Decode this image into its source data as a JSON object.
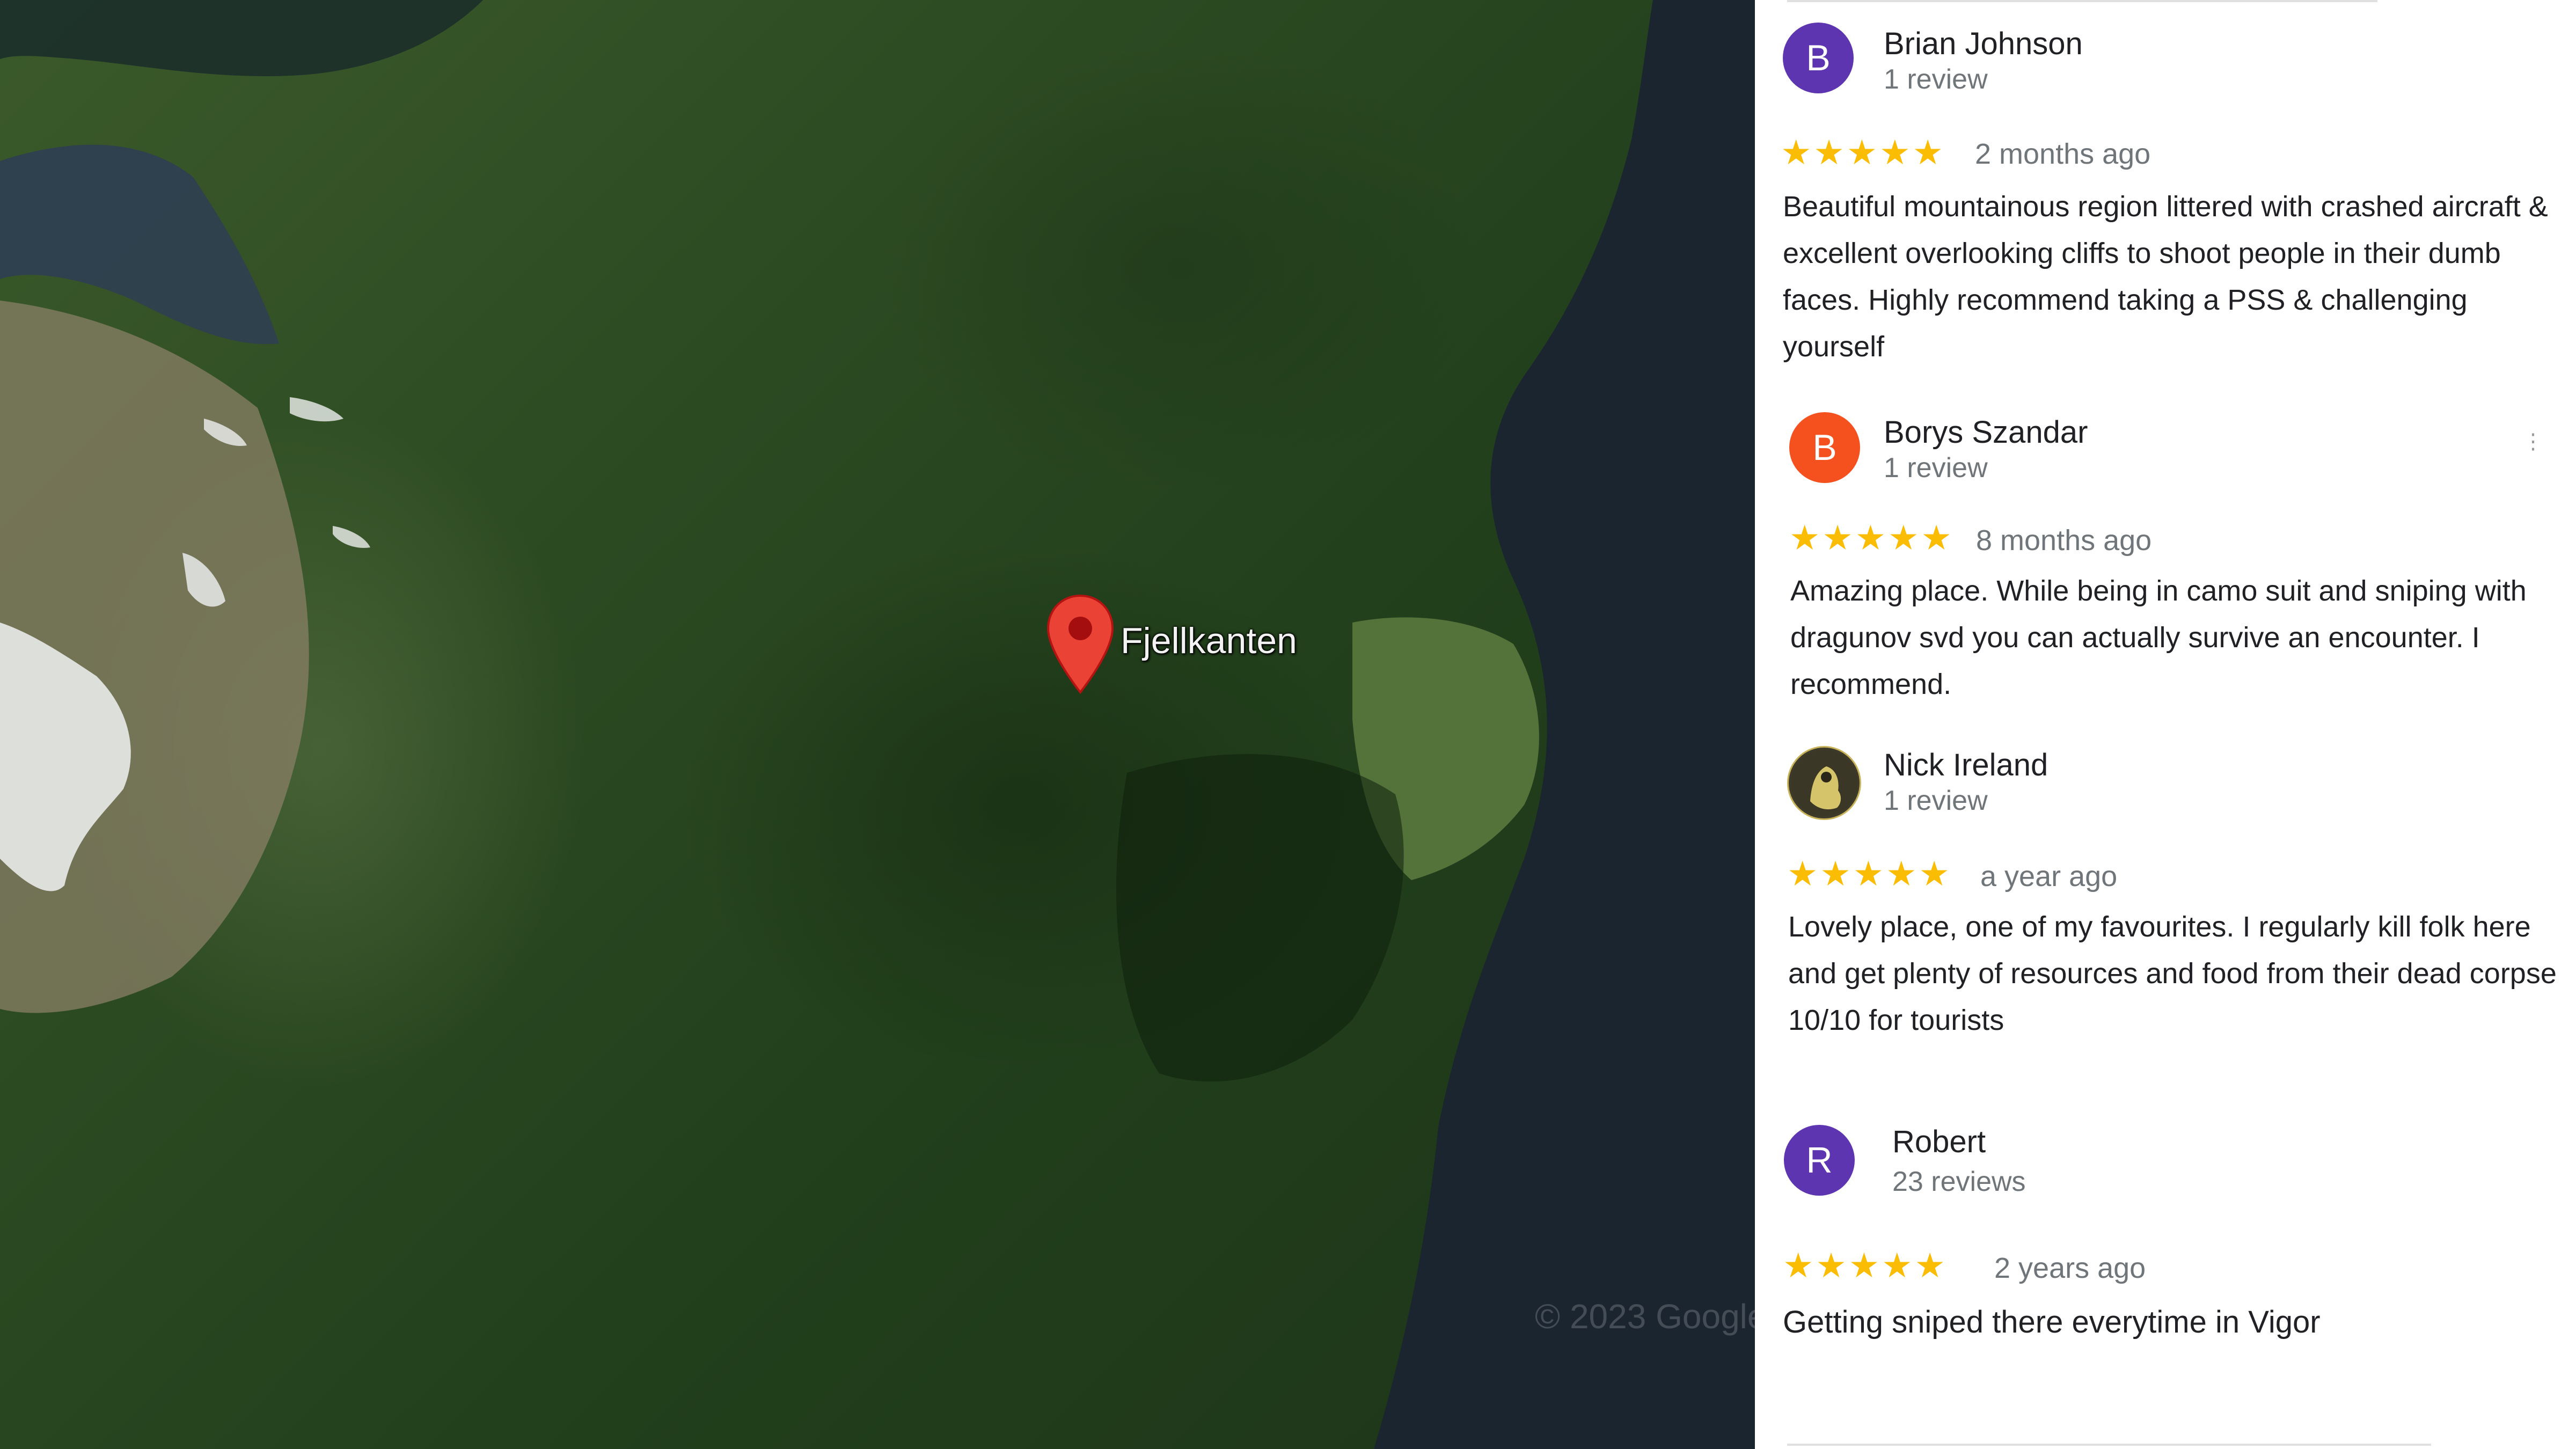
{
  "map": {
    "place_label": "Fjellkanten",
    "watermark": "© 2023 Google",
    "pin_color": "#ea4335"
  },
  "reviews": [
    {
      "initial": "B",
      "avatar_color": "#5e35b1",
      "name": "Brian Johnson",
      "review_count": "1 review",
      "rating": 5,
      "stars": "★★★★★",
      "time": "2 months ago",
      "text": "Beautiful mountainous region littered with crashed aircraft & excellent overlooking cliffs to shoot people in their dumb faces. Highly recommend taking a PSS & challenging yourself"
    },
    {
      "initial": "B",
      "avatar_color": "#f4511e",
      "name": "Borys Szandar",
      "review_count": "1 review",
      "rating": 5,
      "stars": "★★★★★",
      "time": "8 months ago",
      "text": "Amazing place. While being in camo suit and sniping with dragunov svd you can actually survive an encounter. I recommend."
    },
    {
      "initial": "",
      "avatar_color": "#3d3a2a",
      "name": "Nick Ireland",
      "review_count": "1 review",
      "rating": 5,
      "stars": "★★★★★",
      "time": "a year ago",
      "text": "Lovely place, one of my favourites. I regularly kill folk here and get plenty of resources and food from their dead corpse 10/10 for tourists"
    },
    {
      "initial": "R",
      "avatar_color": "#5e35b1",
      "name": "Robert",
      "review_count": "23 reviews",
      "rating": 5,
      "stars": "★★★★★",
      "time": "2 years ago",
      "text": "Getting sniped there everytime in Vigor"
    }
  ],
  "icons": {
    "more": "more-vert-icon"
  },
  "colors": {
    "star": "#fbbc04",
    "text": "#202124",
    "secondary": "#70757a"
  }
}
